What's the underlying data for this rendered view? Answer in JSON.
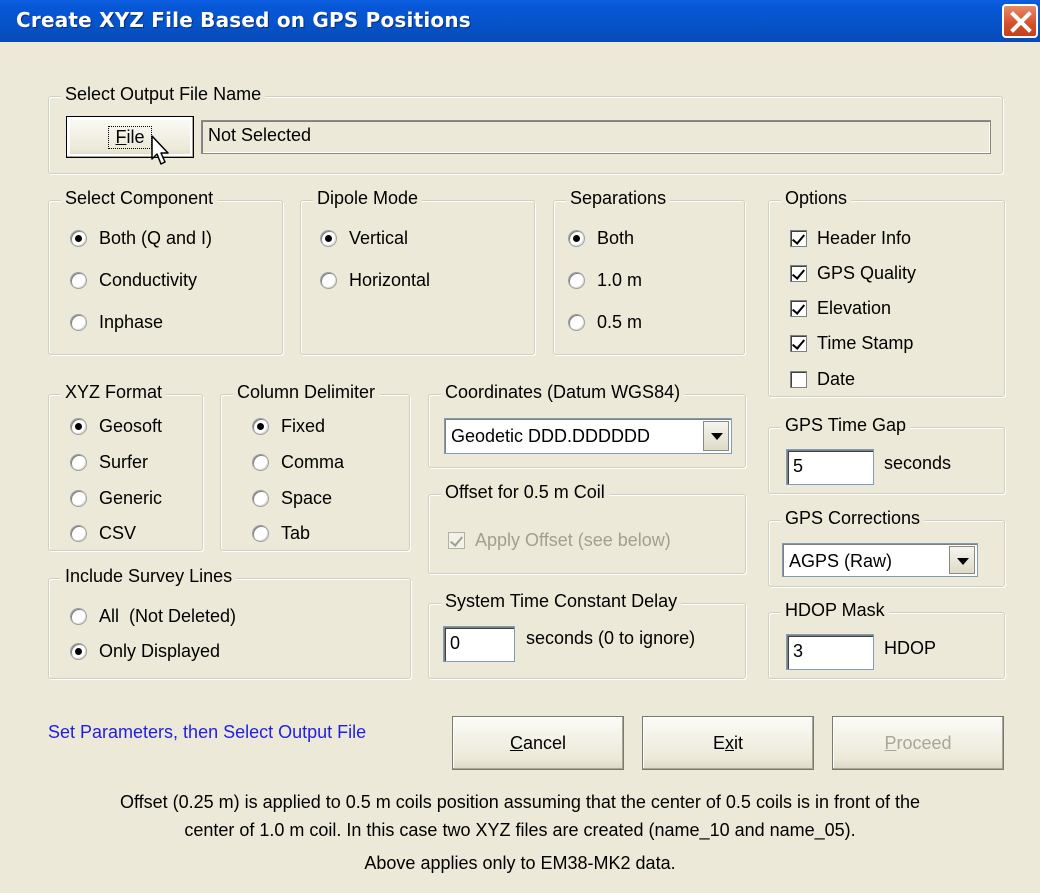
{
  "window": {
    "title": "Create XYZ File Based on GPS Positions"
  },
  "output_file": {
    "group_label": "Select Output File Name",
    "file_button": "File",
    "file_button_mnemonic": "F",
    "file_button_rest": "ile",
    "path_value": "Not Selected"
  },
  "component": {
    "group_label": "Select Component",
    "options": [
      "Both (Q and I)",
      "Conductivity",
      "Inphase"
    ],
    "selected": "Both (Q and I)"
  },
  "dipole": {
    "group_label": "Dipole Mode",
    "options": [
      "Vertical",
      "Horizontal"
    ],
    "selected": "Vertical"
  },
  "separations": {
    "group_label": "Separations",
    "options": [
      "Both",
      "1.0 m",
      "0.5 m"
    ],
    "selected": "Both"
  },
  "options_group": {
    "group_label": "Options",
    "items": [
      {
        "label": "Header Info",
        "checked": true
      },
      {
        "label": "GPS Quality",
        "checked": true
      },
      {
        "label": "Elevation",
        "checked": true
      },
      {
        "label": "Time Stamp",
        "checked": true
      },
      {
        "label": "Date",
        "checked": false
      }
    ]
  },
  "xyz_format": {
    "group_label": "XYZ Format",
    "options": [
      "Geosoft",
      "Surfer",
      "Generic",
      "CSV"
    ],
    "selected": "Geosoft"
  },
  "delimiter": {
    "group_label": "Column Delimiter",
    "options": [
      "Fixed",
      "Comma",
      "Space",
      "Tab"
    ],
    "selected": "Fixed"
  },
  "coordinates": {
    "group_label": "Coordinates (Datum WGS84)",
    "selected": "Geodetic DDD.DDDDDD"
  },
  "offset": {
    "group_label": "Offset for 0.5 m Coil",
    "checkbox_label": "Apply Offset (see below)",
    "checked": true,
    "disabled": true
  },
  "survey_lines": {
    "group_label": "Include Survey Lines",
    "options": [
      "All  (Not Deleted)",
      "Only Displayed"
    ],
    "selected": "Only Displayed"
  },
  "time_delay": {
    "group_label": "System Time Constant Delay",
    "value": "0",
    "unit": "seconds (0 to ignore)"
  },
  "gps_time_gap": {
    "group_label": "GPS Time Gap",
    "value": "5",
    "unit": "seconds"
  },
  "gps_corrections": {
    "group_label": "GPS Corrections",
    "selected": "AGPS (Raw)"
  },
  "hdop": {
    "group_label": "HDOP Mask",
    "value": "3",
    "unit": "HDOP"
  },
  "status": {
    "message": "Set Parameters, then Select Output File"
  },
  "buttons": {
    "cancel_mnemonic": "C",
    "cancel_rest": "ancel",
    "exit_pre": "E",
    "exit_mnemonic": "x",
    "exit_rest": "it",
    "proceed_mnemonic": "P",
    "proceed_rest": "roceed",
    "proceed_disabled": true
  },
  "notes": {
    "line1": "Offset (0.25 m) is applied to 0.5 m coils position assuming that the center of 0.5 coils is in front of the",
    "line2": "center of 1.0 m coil. In this case two XYZ files are created (name_10 and name_05).",
    "line3": "Above applies only to EM38-MK2 data."
  },
  "icons": {
    "close": "close-icon",
    "cursor": "mouse-pointer-icon",
    "dropdown": "chevron-down-icon"
  },
  "colors": {
    "titlebar": "#0453c9",
    "window_bg": "#ece9d8",
    "status_text": "#1f1fe0",
    "close_button": "#d4502a"
  }
}
